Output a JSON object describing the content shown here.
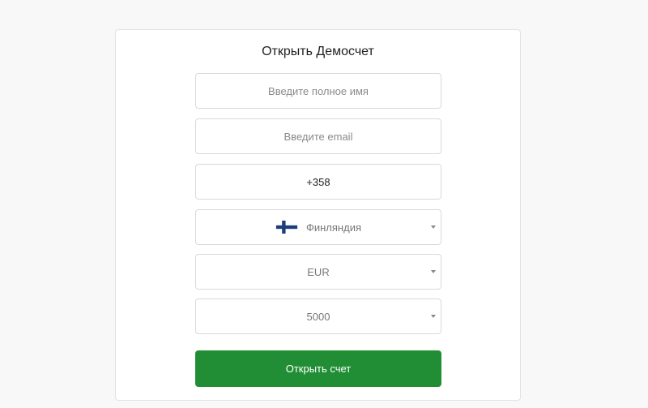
{
  "form": {
    "title": "Открыть Демосчет",
    "name_placeholder": "Введите полное имя",
    "email_placeholder": "Введите email",
    "phone_value": "+358",
    "country": {
      "selected": "Финляндия",
      "flag_icon": "finland-flag-icon"
    },
    "currency": {
      "selected": "EUR"
    },
    "deposit": {
      "selected": "5000"
    },
    "submit_label": "Открыть счет"
  },
  "colors": {
    "accent": "#218e35",
    "flag_blue": "#1c3d7a"
  }
}
